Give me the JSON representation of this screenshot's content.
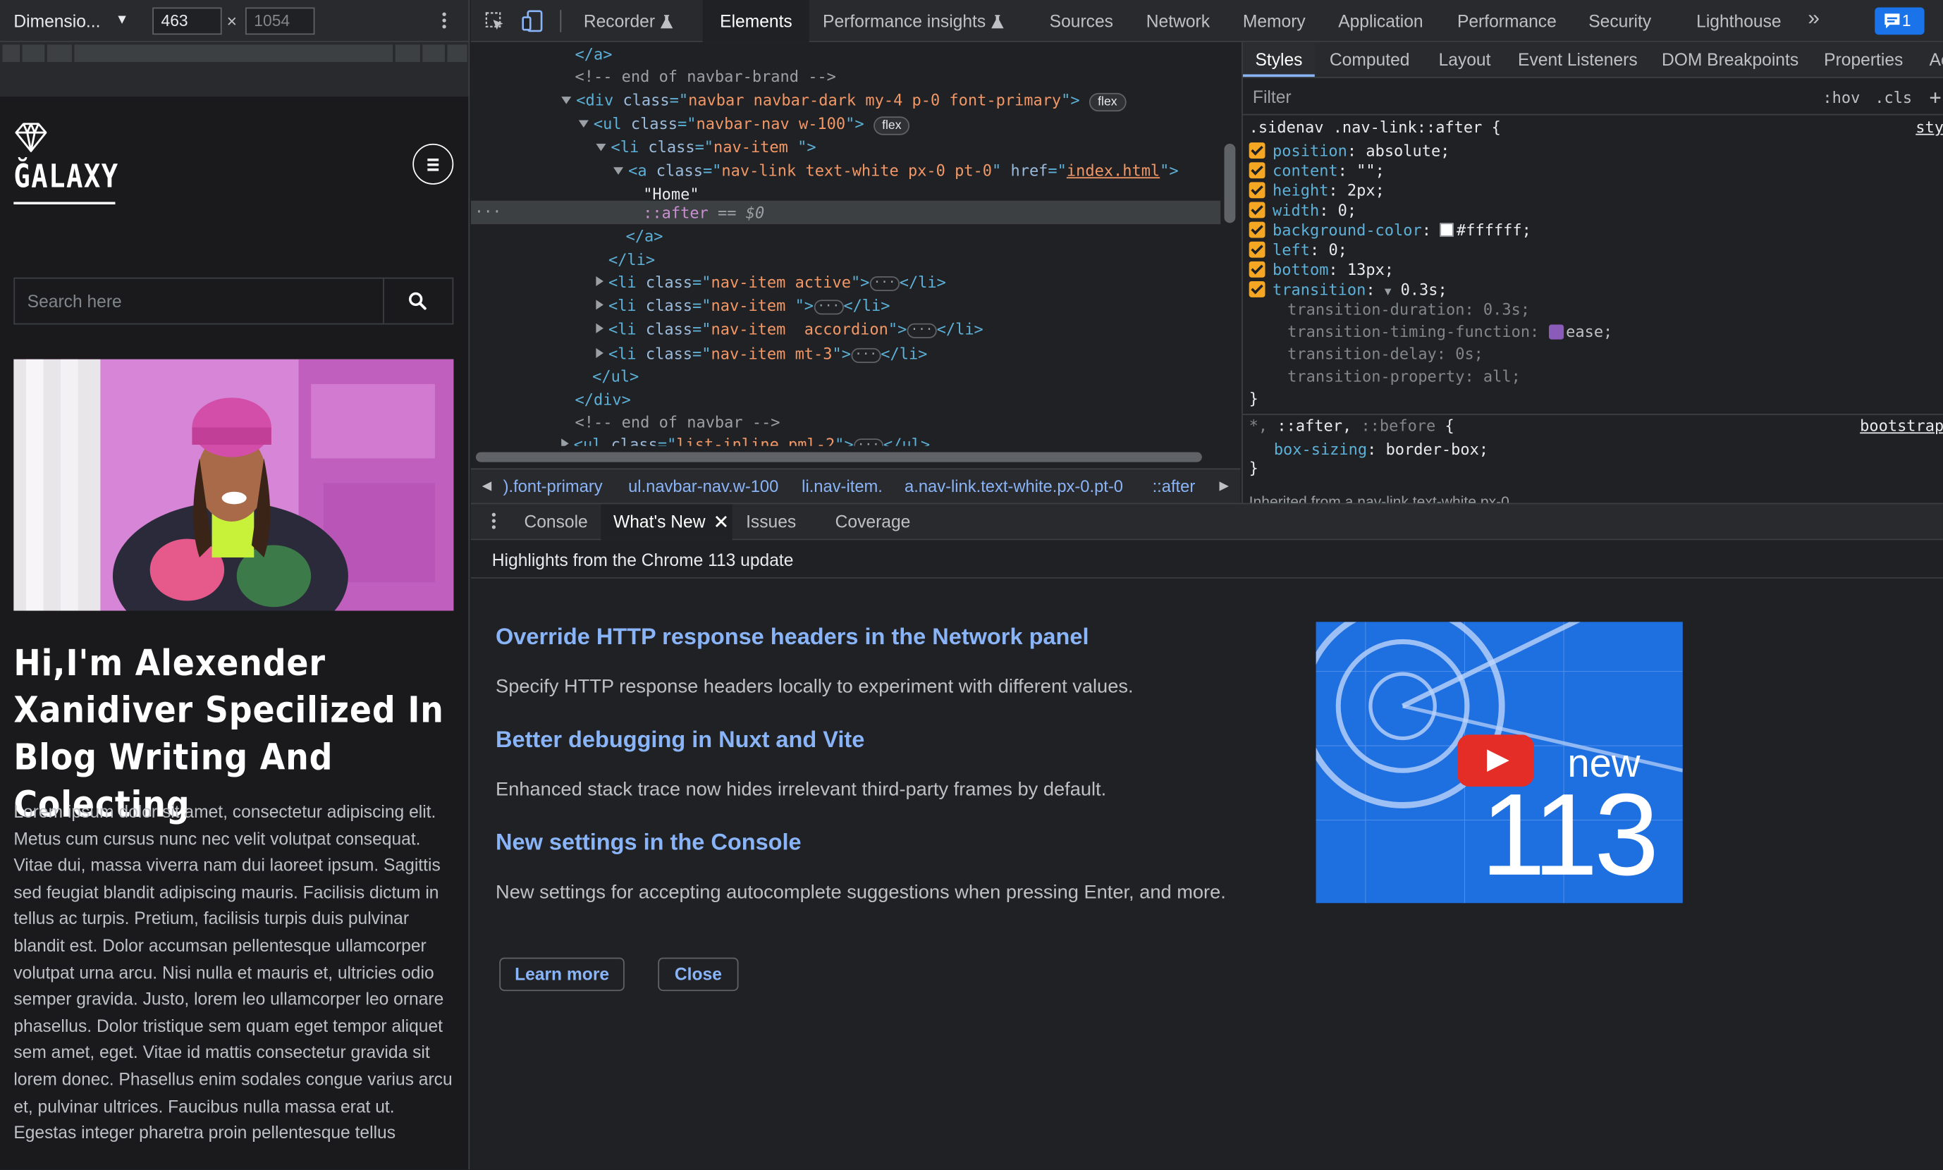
{
  "device_toolbar": {
    "dimension_label": "Dimensio...",
    "width_value": "463",
    "times": "×",
    "height_placeholder": "1054"
  },
  "site": {
    "logo_text": "ĞALAXY",
    "search_placeholder": "Search here",
    "hero_title": "Hi,I'm Alexender Xanidiver Specilized In Blog Writing And Colecting",
    "hero_paragraph": "Lorem ipsum dolor sit amet, consectetur adipiscing elit. Metus cum cursus nunc nec velit volutpat consequat. Vitae dui, massa viverra nam dui laoreet ipsum. Sagittis sed feugiat blandit adipiscing mauris. Facilisis dictum in tellus ac turpis. Pretium, facilisis turpis duis pulvinar blandit est. Dolor accumsan pellentesque ullamcorper volutpat urna arcu. Nisi nulla et mauris et, ultricies odio semper gravida. Justo, lorem leo ullamcorper leo ornare phasellus. Dolor tristique sem quam eget tempor aliquet sem amet, eget. Vitae id mattis consectetur gravida sit lorem donec. Phasellus enim sodales congue varius arcu et, pulvinar ultrices. Faucibus nulla massa erat ut. Egestas integer pharetra proin pellentesque tellus"
  },
  "main_tabs": {
    "recorder": "Recorder",
    "elements": "Elements",
    "performance_insights": "Performance insights",
    "sources": "Sources",
    "network": "Network",
    "memory": "Memory",
    "application": "Application",
    "performance": "Performance",
    "security": "Security",
    "lighthouse": "Lighthouse",
    "more": "»",
    "issues_count": "1"
  },
  "dom_tree": {
    "l0": "</a>",
    "l1": "<!-- end of navbar-brand -->",
    "l2_tag": "div",
    "l2_class": "navbar navbar-dark my-4 p-0 font-primary",
    "l2_badge": "flex",
    "l3_tag": "ul",
    "l3_class": "navbar-nav w-100",
    "l3_badge": "flex",
    "l4_class": "nav-item ",
    "l5_class": "nav-link text-white px-0 pt-0",
    "l5_href": "index.html",
    "l6_text": "\"Home\"",
    "l7_pseudo": "::after",
    "l7_eq": "== $0",
    "l8": "</a>",
    "l9": "</li>",
    "l10_class": "nav-item active",
    "l11_class": "nav-item ",
    "l12_class": "nav-item  accordion",
    "l13_class": "nav-item mt-3",
    "l14": "</ul>",
    "l15": "</div>",
    "l16": "<!-- end of navbar -->",
    "l17_class": "list-inline pml-2"
  },
  "breadcrumbs": [
    ").font-primary",
    "ul.navbar-nav.w-100",
    "li.nav-item.",
    "a.nav-link.text-white.px-0.pt-0",
    "::after"
  ],
  "styles_tabs": {
    "styles": "Styles",
    "computed": "Computed",
    "layout": "Layout",
    "event_listeners": "Event Listeners",
    "dom_breakpoints": "DOM Breakpoints",
    "properties": "Properties",
    "accessibility": "Ac"
  },
  "styles": {
    "filter_placeholder": "Filter",
    "hov": ":hov",
    "cls": ".cls",
    "plus": "+",
    "selector": ".sidenav .nav-link::after {",
    "source": "sty",
    "p1n": "position",
    "p1v": "absolute;",
    "p2n": "content",
    "p2v": "\"\";",
    "p3n": "height",
    "p3v": "2px;",
    "p4n": "width",
    "p4v": "0;",
    "p5n": "background-color",
    "p5v": "#ffffff;",
    "p6n": "left",
    "p6v": "0;",
    "p7n": "bottom",
    "p7v": "13px;",
    "p8n": "transition",
    "p8v": "0.3s;",
    "s1": "transition-duration: 0.3s;",
    "s2n": "transition-timing-function:",
    "s2v": "ease;",
    "s3": "transition-delay: 0s;",
    "s4": "transition-property: all;",
    "close": "}",
    "rule2_selector_a": "*,",
    "rule2_selector_b": "::after,",
    "rule2_selector_c": "::before",
    "rule2_brace": "{",
    "rule2_source": "bootstrap",
    "rule2_prop": "box-sizing",
    "rule2_val": "border-box;",
    "inherited": "Inherited from a.nav-link.text-white.px-0"
  },
  "drawer": {
    "console": "Console",
    "whats_new": "What's New",
    "issues": "Issues",
    "coverage": "Coverage",
    "header": "Highlights from the Chrome 113 update"
  },
  "whats_new": {
    "h1": "Override HTTP response headers in the Network panel",
    "p1": "Specify HTTP response headers locally to experiment with different values.",
    "h2": "Better debugging in Nuxt and Vite",
    "p2": "Enhanced stack trace now hides irrelevant third-party frames by default.",
    "h3": "New settings in the Console",
    "p3": "New settings for accepting autocomplete suggestions when pressing Enter, and more.",
    "thumb_new": "new",
    "thumb_num": "113",
    "learn_more": "Learn more",
    "close": "Close"
  },
  "colors": {
    "accent_link": "#8ab4f8",
    "checkbox": "#f5a623",
    "thumb_bg": "#1e6fe0"
  }
}
